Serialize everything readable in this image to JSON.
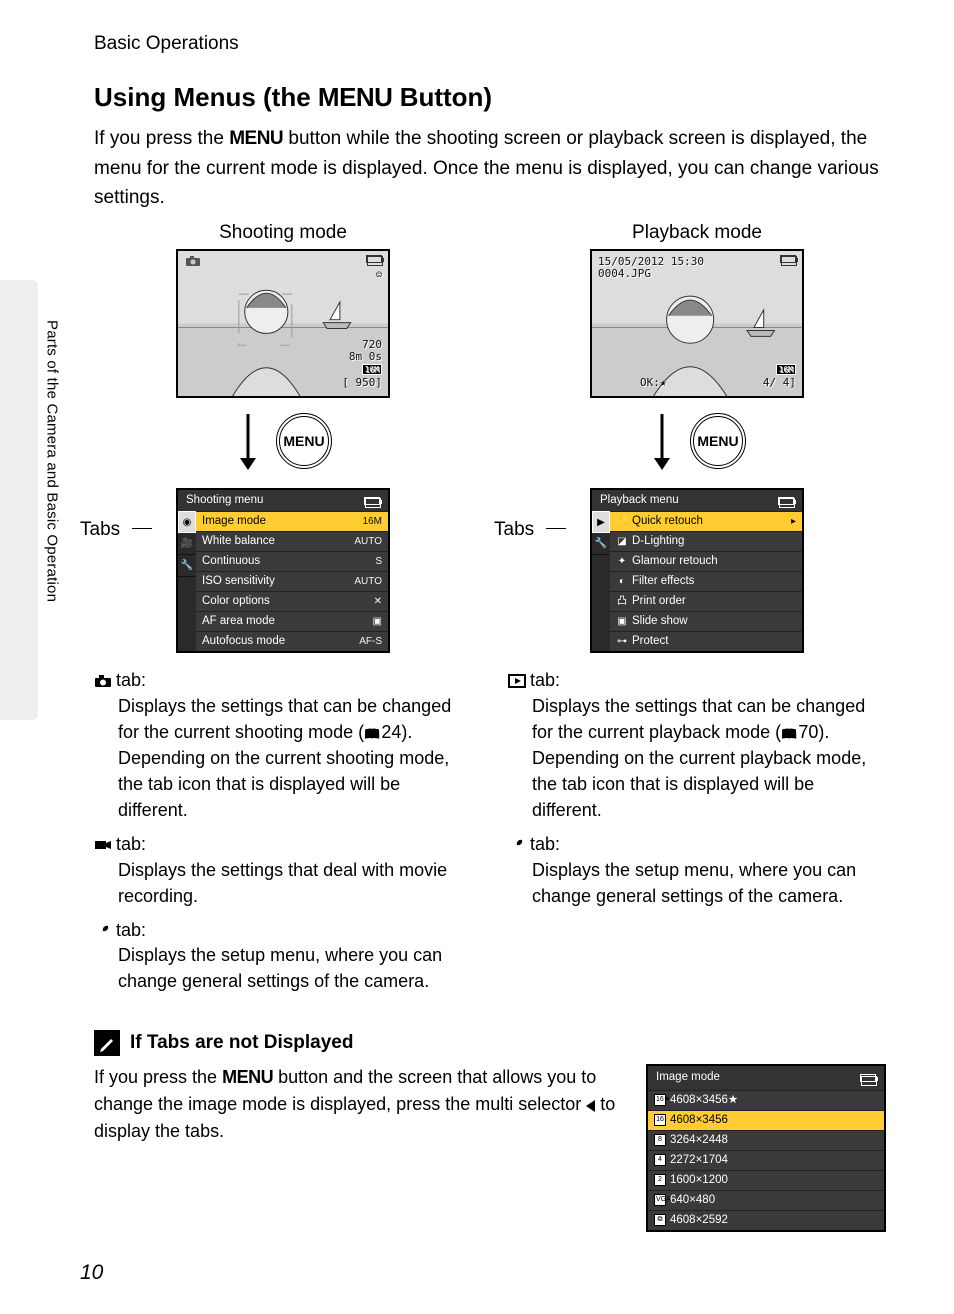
{
  "breadcrumb": "Basic Operations",
  "side_label": "Parts of the Camera and Basic Operation",
  "heading_pre": "Using Menus (the ",
  "heading_menu": "MENU",
  "heading_post": " Button)",
  "intro_1": "If you press the ",
  "intro_menu": "MENU",
  "intro_2": " button while the shooting screen or playback screen is displayed, the menu for the current mode is displayed. Once the menu is displayed, you can change various settings.",
  "page_number": "10",
  "shooting": {
    "title": "Shooting mode",
    "lcd": {
      "r1": "720",
      "r2": "8m 0s",
      "r3": "16M",
      "r4": "[  950]"
    },
    "tabs_label": "Tabs",
    "menu_title": "Shooting menu",
    "items": [
      {
        "label": "Image mode",
        "val": "16M",
        "sel": true
      },
      {
        "label": "White balance",
        "val": "AUTO"
      },
      {
        "label": "Continuous",
        "val": "S"
      },
      {
        "label": "ISO sensitivity",
        "val": "AUTO"
      },
      {
        "label": "Color options",
        "val": "✕"
      },
      {
        "label": "AF area mode",
        "val": "▣"
      },
      {
        "label": "Autofocus mode",
        "val": "AF-S"
      }
    ],
    "desc": [
      {
        "icon": "camera",
        "head": "tab:",
        "body_a": "Displays the settings that can be changed for the current shooting mode (",
        "ref": "24",
        "body_b": "). Depending on the current shooting mode, the tab icon that is displayed will be different."
      },
      {
        "icon": "movie",
        "head": "tab:",
        "body": "Displays the settings that deal with movie recording."
      },
      {
        "icon": "wrench",
        "head": "tab:",
        "body": "Displays the setup menu, where you can change general settings of the camera."
      }
    ]
  },
  "playback": {
    "title": "Playback mode",
    "lcd": {
      "date": "15/05/2012 15:30",
      "file": "0004.JPG",
      "r3": "16M",
      "ok": "OK:",
      "count": "4/   4]"
    },
    "tabs_label": "Tabs",
    "menu_title": "Playback menu",
    "items": [
      {
        "icon": "✨",
        "label": "Quick retouch",
        "sel": true
      },
      {
        "icon": "◪",
        "label": "D-Lighting"
      },
      {
        "icon": "✦",
        "label": "Glamour retouch"
      },
      {
        "icon": "◐",
        "label": "Filter effects"
      },
      {
        "icon": "凸",
        "label": "Print order"
      },
      {
        "icon": "▣",
        "label": "Slide show"
      },
      {
        "icon": "⊶",
        "label": "Protect"
      }
    ],
    "desc": [
      {
        "icon": "play",
        "head": "tab:",
        "body_a": "Displays the settings that can be changed for the current playback mode (",
        "ref": "70",
        "body_b": "). Depending on the current playback mode, the tab icon that is displayed will be different."
      },
      {
        "icon": "wrench",
        "head": "tab:",
        "body": "Displays the setup menu, where you can change general settings of the camera."
      }
    ]
  },
  "note": {
    "title": "If Tabs are not Displayed",
    "body_a": "If you press the ",
    "body_menu": "MENU",
    "body_b": " button and the screen that allows you to change the image mode is displayed, press the multi selector ",
    "body_c": " to display the tabs.",
    "panel_title": "Image mode",
    "items": [
      {
        "icon": "16★",
        "label": "4608×3456★"
      },
      {
        "icon": "16",
        "label": "4608×3456",
        "sel": true
      },
      {
        "icon": "8",
        "label": "3264×2448"
      },
      {
        "icon": "4",
        "label": "2272×1704"
      },
      {
        "icon": "2",
        "label": "1600×1200"
      },
      {
        "icon": "VGA",
        "label": "640×480"
      },
      {
        "icon": "⧉",
        "label": "4608×2592"
      }
    ]
  }
}
